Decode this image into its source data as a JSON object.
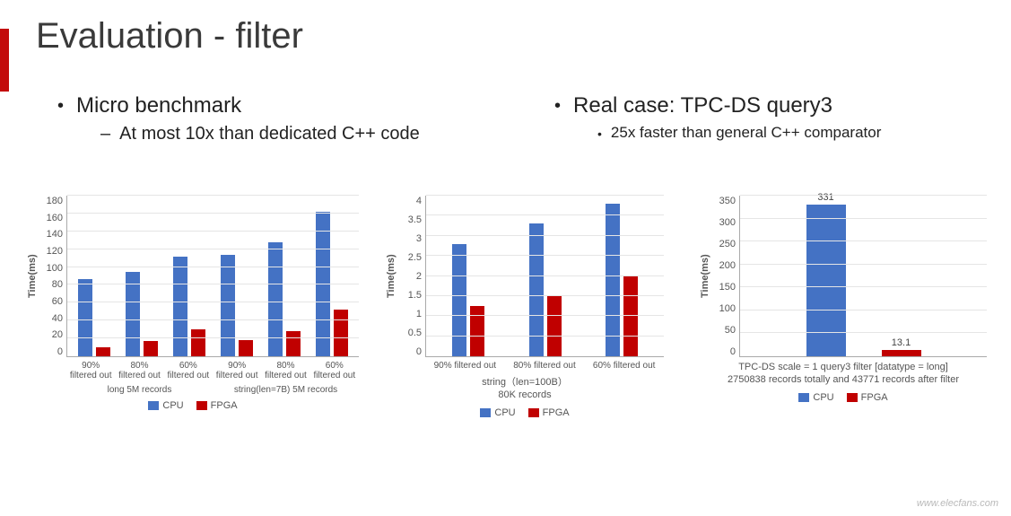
{
  "title": "Evaluation - filter",
  "left": {
    "bullet": "Micro benchmark",
    "sub": "At most 10x than dedicated C++ code"
  },
  "right": {
    "bullet": "Real case: TPC-DS query3",
    "sub": "25x faster than general C++ comparator"
  },
  "legend": {
    "cpu": "CPU",
    "fpga": "FPGA"
  },
  "ylabel": "Time(ms)",
  "chart_data": [
    {
      "type": "bar",
      "ylabel": "Time(ms)",
      "ylim": [
        0,
        180
      ],
      "yticks": [
        0,
        20,
        40,
        60,
        80,
        100,
        120,
        140,
        160,
        180
      ],
      "categories": [
        "90% filtered out",
        "80% filtered out",
        "60% filtered out",
        "90% filtered out",
        "80% filtered out",
        "60% filtered out"
      ],
      "group_labels": [
        "long\n5M records",
        "string(len=7B)\n5M records"
      ],
      "series": [
        {
          "name": "CPU",
          "values": [
            86,
            95,
            112,
            114,
            128,
            162
          ]
        },
        {
          "name": "FPGA",
          "values": [
            10,
            17,
            30,
            18,
            28,
            52
          ]
        }
      ]
    },
    {
      "type": "bar",
      "ylabel": "Time(ms)",
      "ylim": [
        0,
        4
      ],
      "yticks": [
        0,
        0.5,
        1,
        1.5,
        2,
        2.5,
        3,
        3.5,
        4
      ],
      "categories": [
        "90% filtered out",
        "80% filtered out",
        "60% filtered out"
      ],
      "subtitle": "string（len=100B）\n80K records",
      "series": [
        {
          "name": "CPU",
          "values": [
            2.8,
            3.3,
            3.8
          ]
        },
        {
          "name": "FPGA",
          "values": [
            1.25,
            1.5,
            2.0
          ]
        }
      ]
    },
    {
      "type": "bar",
      "ylabel": "Time(ms)",
      "ylim": [
        0,
        350
      ],
      "yticks": [
        0,
        50,
        100,
        150,
        200,
        250,
        300,
        350
      ],
      "categories": [
        "CPU",
        "FPGA"
      ],
      "values": [
        331,
        13.1
      ],
      "data_labels": [
        "331",
        "13.1"
      ],
      "subtitle": "TPC-DS scale = 1 query3 filter [datatype = long]\n2750838 records totally and 43771 records after filter",
      "series": [
        {
          "name": "CPU",
          "values": [
            331
          ]
        },
        {
          "name": "FPGA",
          "values": [
            13.1
          ]
        }
      ]
    }
  ],
  "chart1_groups": [
    "long 5M records",
    "string(len=7B) 5M records"
  ],
  "chart2_sub1": "string（len=100B）",
  "chart2_sub2": "80K records",
  "chart3_sub1": "TPC-DS scale = 1 query3 filter [datatype = long]",
  "chart3_sub2": "2750838 records totally and 43771 records after filter",
  "watermark": "www.elecfans.com"
}
